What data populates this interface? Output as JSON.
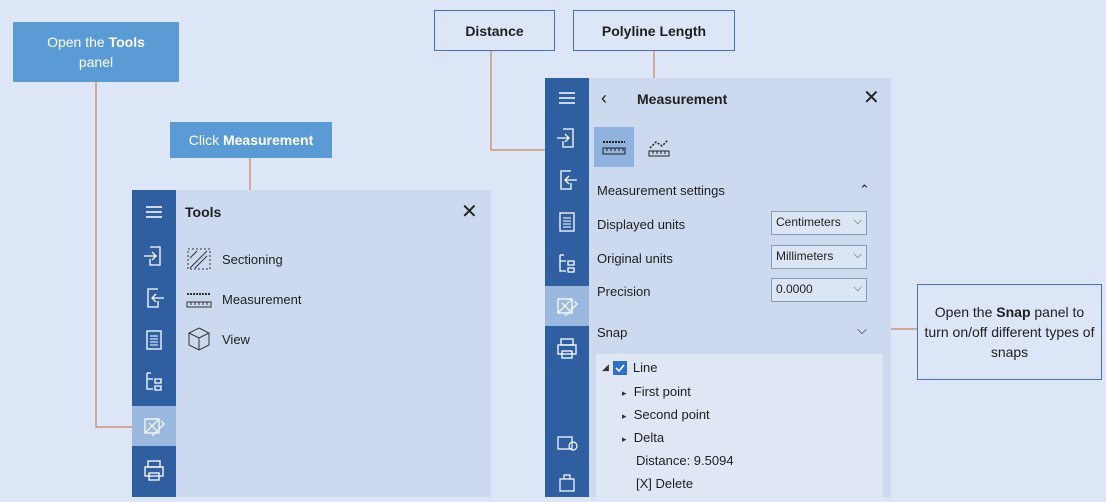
{
  "callouts": {
    "open_tools_prefix": "Open the ",
    "open_tools_bold": "Tools",
    "open_tools_suffix": "panel",
    "click_prefix": "Click ",
    "click_bold": "Measurement",
    "distance": "Distance",
    "polyline_length": "Polyline Length",
    "snap_prefix": "Open the ",
    "snap_bold": "Snap",
    "snap_suffix": " panel to turn on/off different types of snaps"
  },
  "tools_panel": {
    "title": "Tools",
    "items": [
      {
        "label": "Sectioning",
        "icon": "sectioning-icon"
      },
      {
        "label": "Measurement",
        "icon": "measurement-ruler-icon"
      },
      {
        "label": "View",
        "icon": "view-cube-icon"
      }
    ]
  },
  "measurement_panel": {
    "title": "Measurement",
    "settings_header": "Measurement settings",
    "rows": [
      {
        "label": "Displayed units",
        "value": "Centimeters"
      },
      {
        "label": "Original units",
        "value": "Millimeters"
      },
      {
        "label": "Precision",
        "value": "0.0000"
      }
    ],
    "snap_header": "Snap",
    "tree": {
      "root": "Line",
      "children": [
        "First point",
        "Second point",
        "Delta"
      ],
      "distance": "Distance: 9.5094",
      "delete": "[X] Delete"
    }
  },
  "colors": {
    "rail": "#2f5fa0",
    "callout_blue": "#5b9bd5",
    "connector": "#c9825a",
    "background": "#dce6f7"
  }
}
